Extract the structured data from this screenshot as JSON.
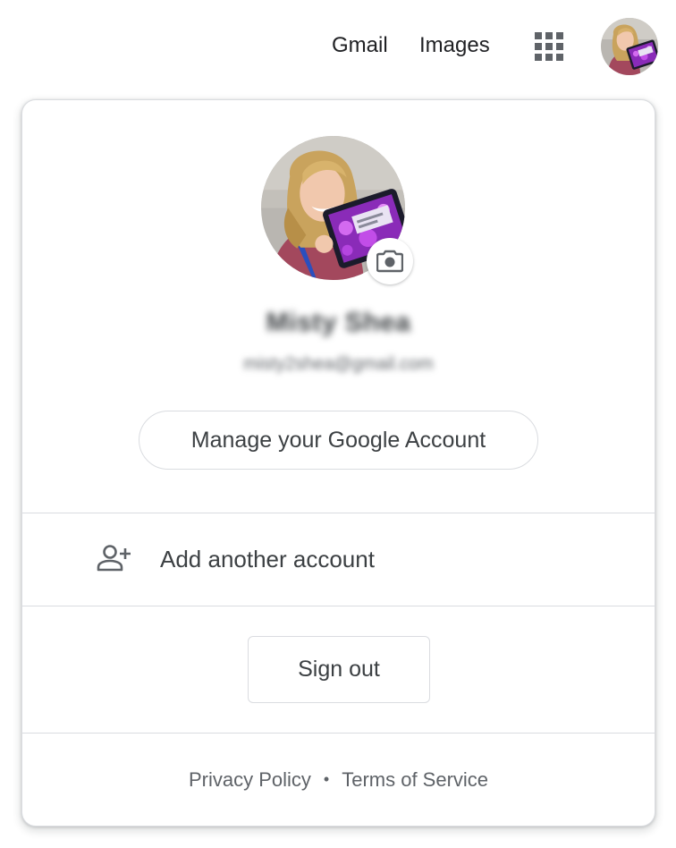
{
  "header": {
    "links": [
      {
        "label": "Gmail"
      },
      {
        "label": "Images"
      }
    ],
    "apps_icon": "apps-grid-icon",
    "avatar_icon": "profile-photo"
  },
  "account_card": {
    "user_name": "Misty Shea",
    "user_email": "misty2shea@gmail.com",
    "camera_icon": "camera-icon",
    "manage_label": "Manage your Google Account",
    "add_account": {
      "icon": "person-add-icon",
      "label": "Add another account"
    },
    "sign_out_label": "Sign out",
    "footer": {
      "privacy": "Privacy Policy",
      "separator": "•",
      "terms": "Terms of Service"
    }
  },
  "colors": {
    "text_primary": "#3c4043",
    "text_secondary": "#5f6368",
    "border": "#dadce0",
    "icon_gray": "#5f6368"
  }
}
